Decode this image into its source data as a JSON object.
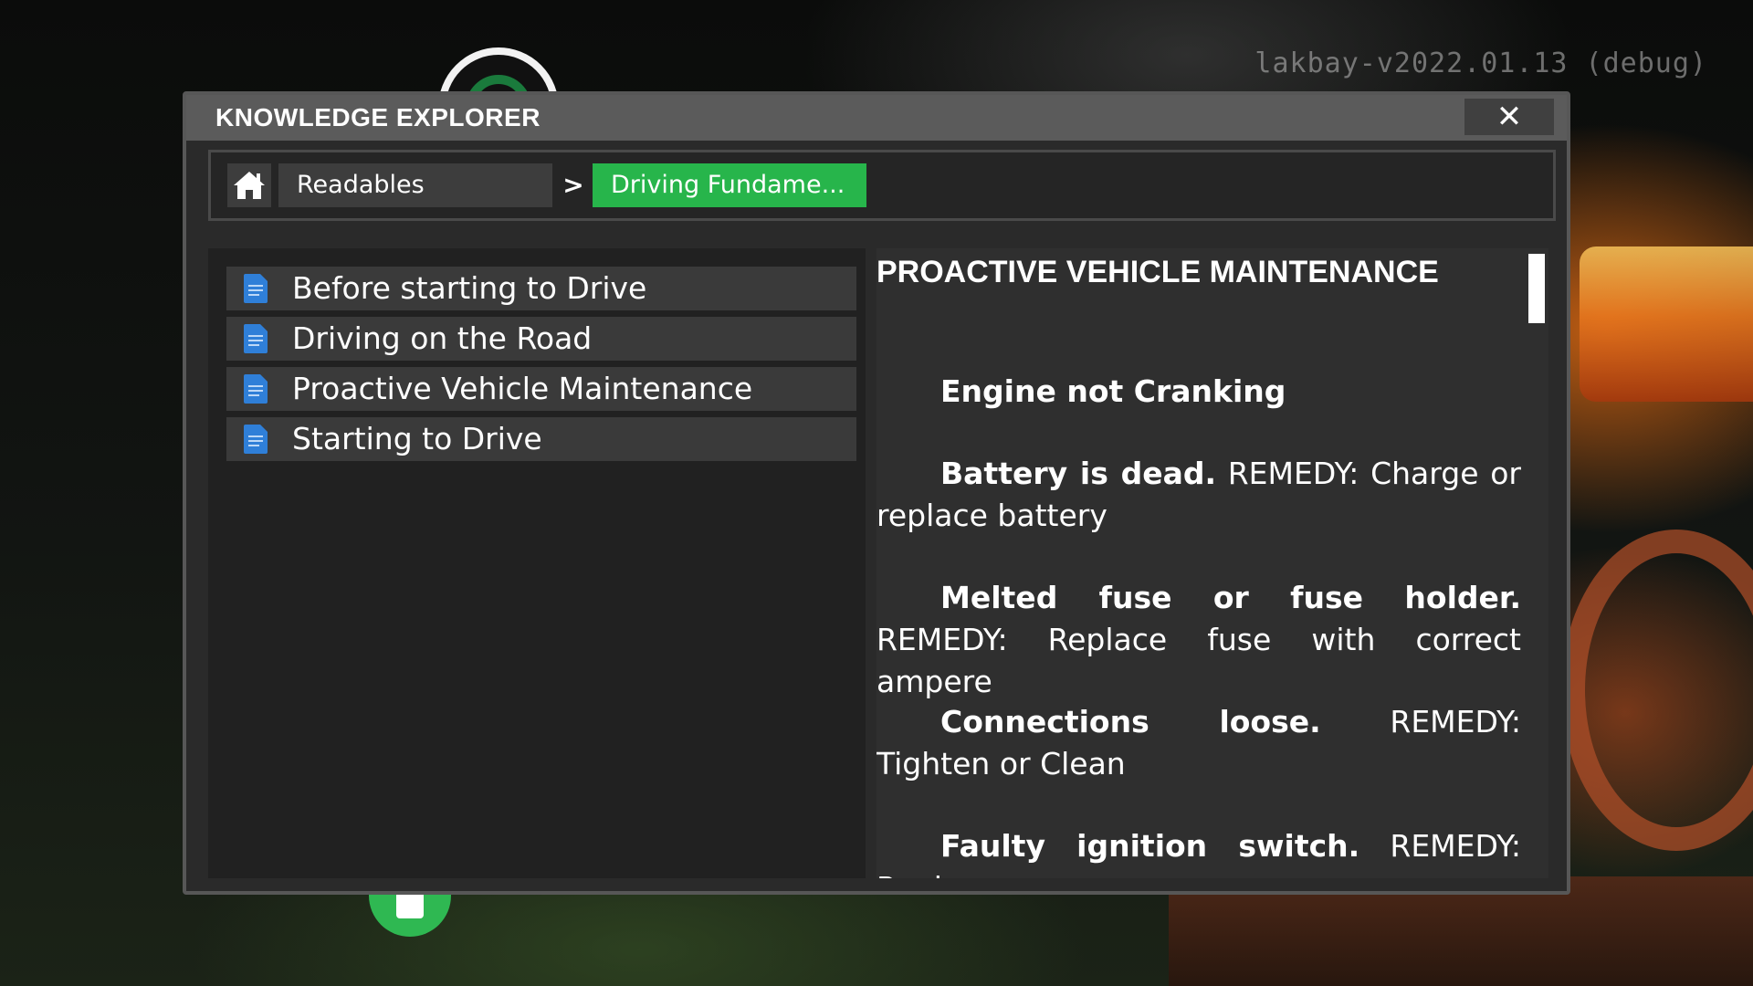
{
  "version_text": "lakbay-v2022.01.13 (debug)",
  "window": {
    "title": "KNOWLEDGE EXPLORER",
    "close_label": "✕"
  },
  "breadcrumb": {
    "home_icon": "home-icon",
    "items": [
      "Readables",
      "Driving Fundame..."
    ],
    "separator": ">"
  },
  "list": {
    "items": [
      {
        "label": "Before starting to Drive",
        "icon": "document-icon"
      },
      {
        "label": "Driving on the Road",
        "icon": "document-icon"
      },
      {
        "label": "Proactive Vehicle Maintenance",
        "icon": "document-icon"
      },
      {
        "label": "Starting to Drive",
        "icon": "document-icon"
      }
    ]
  },
  "article": {
    "title": "PROACTIVE VEHICLE MAINTENANCE",
    "heading": "Engine not Cranking",
    "entries": [
      {
        "problem": "Battery is dead.",
        "remedy": " REMEDY: Charge or replace battery"
      },
      {
        "problem": "Melted fuse or fuse holder.",
        "remedy": " REMEDY: Replace fuse with correct ampere"
      },
      {
        "problem": "Connections loose.",
        "remedy": " REMEDY: Tighten or Clean"
      },
      {
        "problem": "Faulty ignition switch.",
        "remedy": " REMEDY: Replace"
      }
    ]
  },
  "colors": {
    "accent": "#27b54b",
    "doc_icon": "#2f7fd8"
  }
}
